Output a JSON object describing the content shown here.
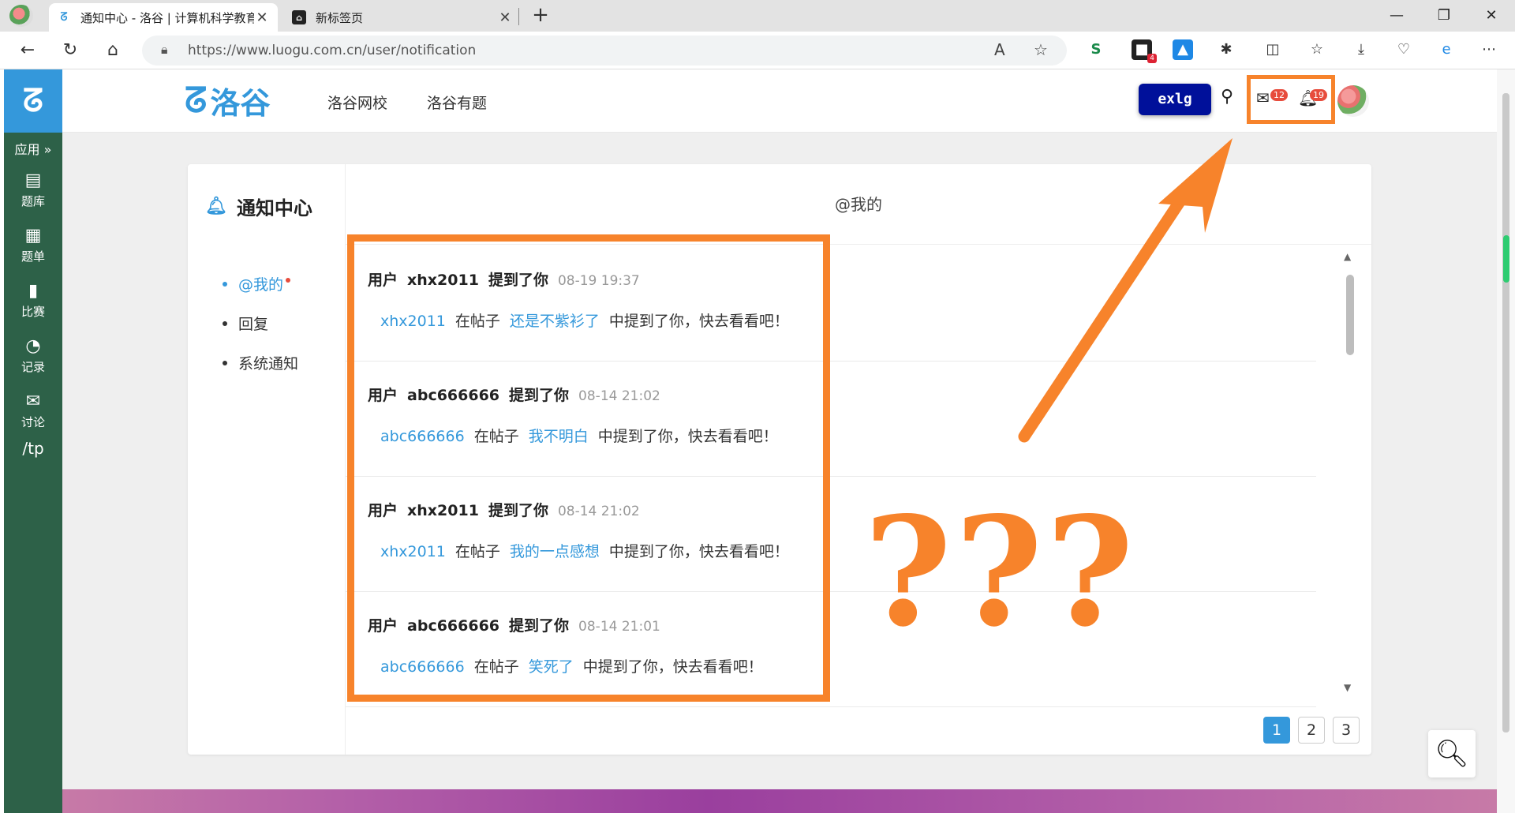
{
  "browser": {
    "tabs": [
      {
        "title": "通知中心 - 洛谷 | 计算机科学教育",
        "close": "✕"
      },
      {
        "title": "新标签页",
        "close": "✕"
      }
    ],
    "new_tab": "+",
    "url": "https://www.luogu.com.cn/user/notification",
    "window_controls": {
      "minimize": "—",
      "maximize": "❐",
      "close": "✕"
    },
    "extension_badge": "4"
  },
  "appbar": {
    "logo": "ᘔ",
    "menu_label": "应用 »",
    "items": [
      {
        "icon": "▤",
        "label": "题库"
      },
      {
        "icon": "▦",
        "label": "题单"
      },
      {
        "icon": "▮",
        "label": "比赛"
      },
      {
        "icon": "◔",
        "label": "记录"
      },
      {
        "icon": "✉",
        "label": "讨论"
      }
    ],
    "extra": "/tp"
  },
  "header": {
    "brand": "洛谷",
    "nav": [
      "洛谷网校",
      "洛谷有题"
    ],
    "exlg": "exlg",
    "messages_badge": "12",
    "notifications_badge": "19"
  },
  "sidebar": {
    "title": "通知中心",
    "items": [
      {
        "label": "@我的"
      },
      {
        "label": "回复"
      },
      {
        "label": "系统通知"
      }
    ]
  },
  "main": {
    "title": "@我的",
    "notifications": [
      {
        "user": "xhx2011",
        "time": "08-19 19:37",
        "post": "还是不紫衫了"
      },
      {
        "user": "abc666666",
        "time": "08-14 21:02",
        "post": "我不明白"
      },
      {
        "user": "xhx2011",
        "time": "08-14 21:02",
        "post": "我的一点感想"
      },
      {
        "user": "abc666666",
        "time": "08-14 21:01",
        "post": "笑死了"
      }
    ],
    "strings": {
      "head_prefix": "用户",
      "head_suffix": "提到了你",
      "in_post": "在帖子",
      "tail": "中提到了你，快去看看吧！"
    },
    "pagination": [
      "1",
      "2",
      "3"
    ]
  },
  "annotations": {
    "question_marks": "???",
    "accent_color": "#f7832b"
  }
}
